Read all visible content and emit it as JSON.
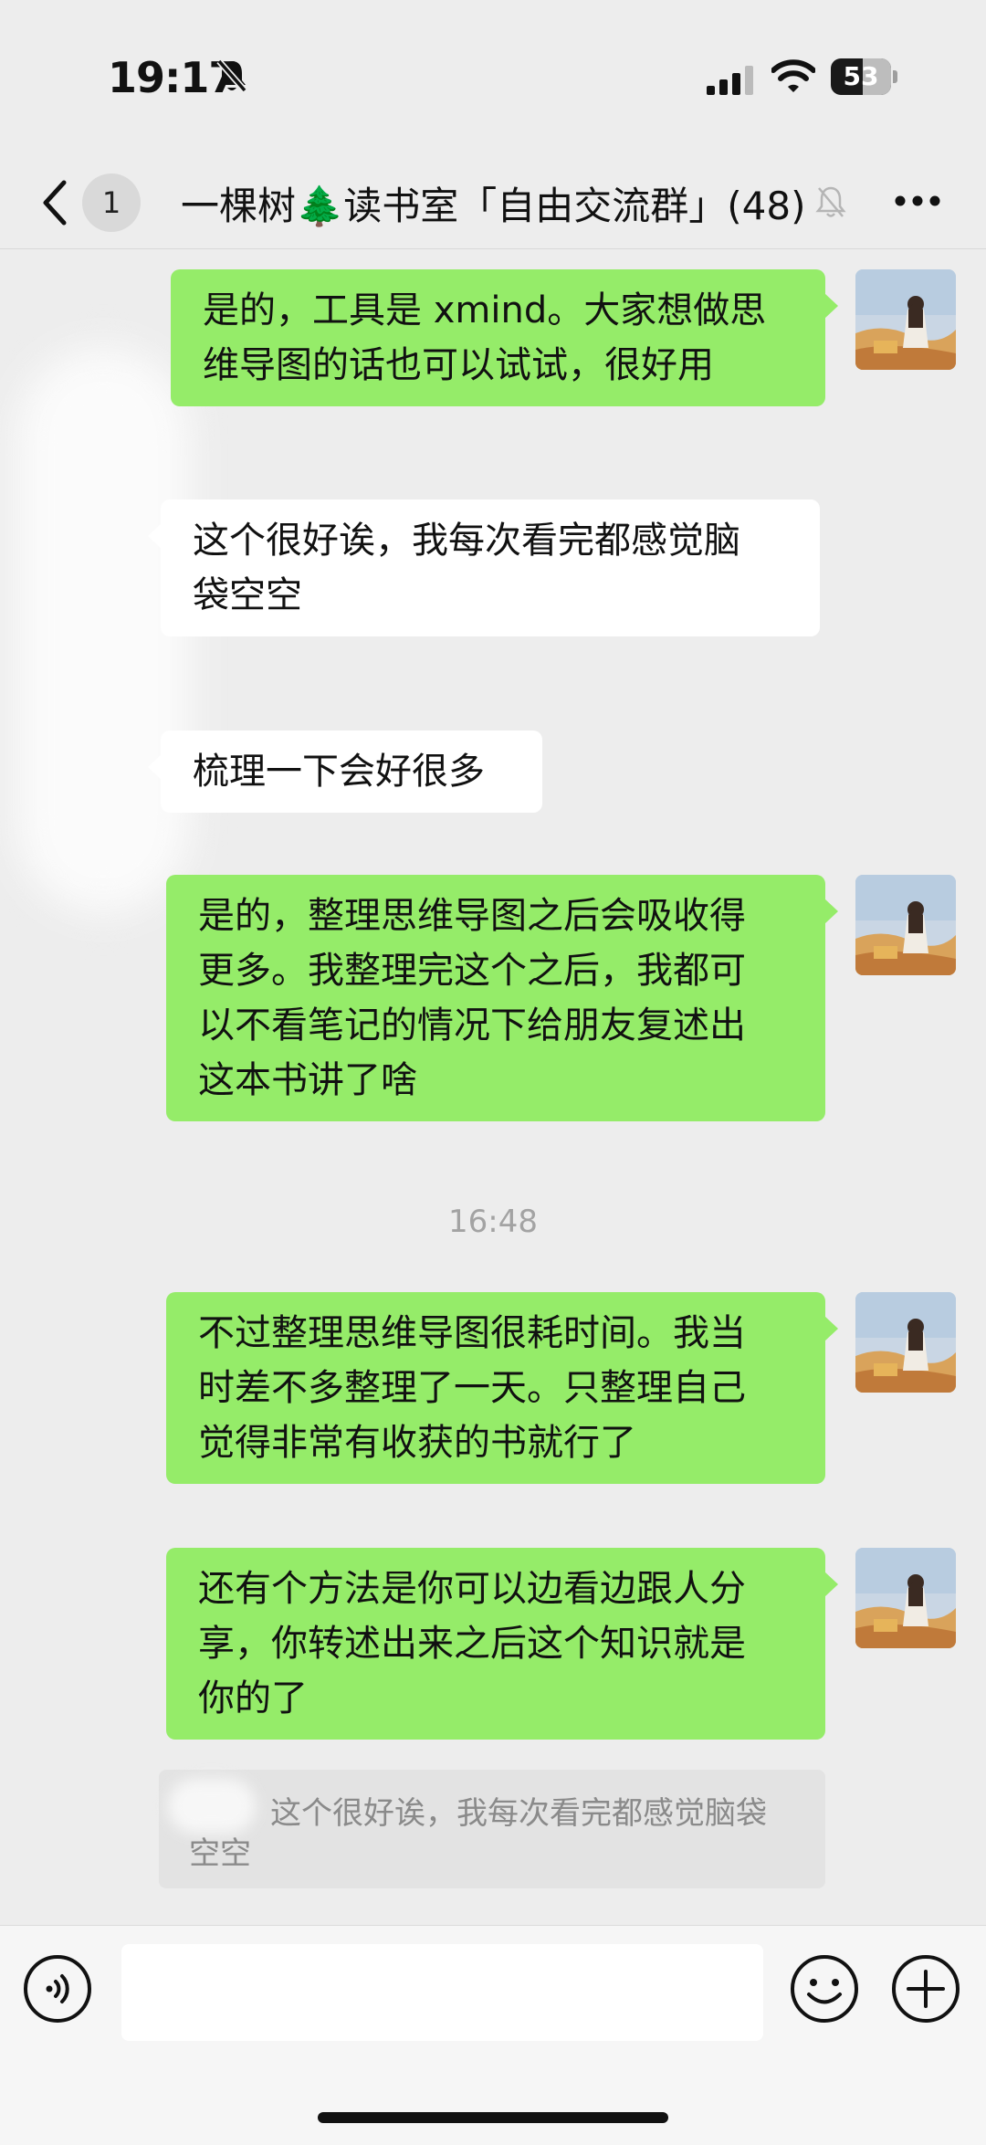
{
  "status_bar": {
    "time": "19:17",
    "battery": "53",
    "battery_level": 0.53
  },
  "header": {
    "unread_count": "1",
    "title": "一棵树🌲读书室「自由交流群」(48)"
  },
  "messages": [
    {
      "id": "m1",
      "side": "out",
      "lines": [
        "是的，工具是 xmind。大家想做思",
        "维导图的话也可以试试，很好用"
      ]
    },
    {
      "id": "m2",
      "side": "in",
      "lines": [
        "这个很好诶，我每次看完都感觉脑",
        "袋空空"
      ]
    },
    {
      "id": "m3",
      "side": "in",
      "lines": [
        "梳理一下会好很多"
      ]
    },
    {
      "id": "m4",
      "side": "out",
      "lines": [
        "是的，整理思维导图之后会吸收得",
        "更多。我整理完这个之后，我都可",
        "以不看笔记的情况下给朋友复述出",
        "这本书讲了啥"
      ]
    },
    {
      "id": "m5",
      "side": "out",
      "lines": [
        "不过整理思维导图很耗时间。我当",
        "时差不多整理了一天。只整理自己",
        "觉得非常有收获的书就行了"
      ]
    },
    {
      "id": "m6",
      "side": "out",
      "lines": [
        "还有个方法是你可以边看边跟人分",
        "享，你转述出来之后这个知识就是",
        "你的了"
      ]
    }
  ],
  "timestamp": "16:48",
  "quote": {
    "line1": "这个很好诶，我每次看完都感觉脑袋",
    "line2": "空空"
  },
  "input": {
    "value": "",
    "placeholder": ""
  },
  "colors": {
    "background": "#ededed",
    "outgoing_bubble": "#95ec69",
    "incoming_bubble": "#ffffff",
    "timestamp": "#a3a3a3"
  },
  "icons": {
    "back": "chevron-left-icon",
    "mute": "bell-slash-icon",
    "more": "more-dots-icon",
    "voice": "voice-icon",
    "emoji": "emoji-icon",
    "plus": "plus-icon"
  }
}
